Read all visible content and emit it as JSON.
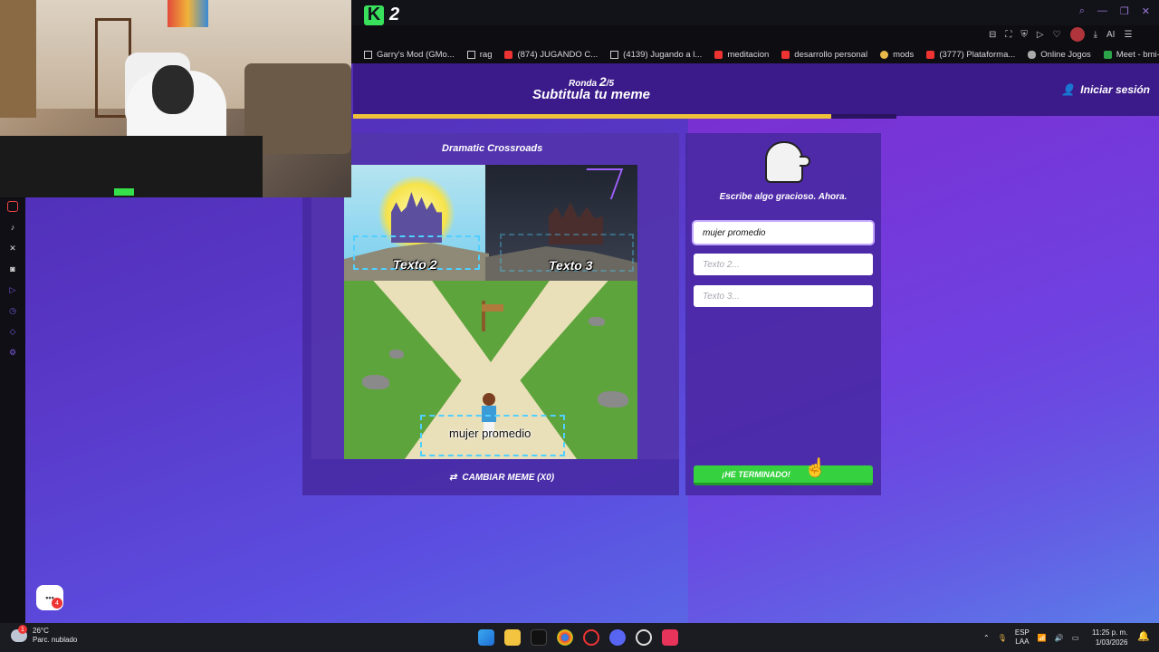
{
  "browser": {
    "app_logo": "K",
    "app_logo_suffix": "2",
    "bookmarks": [
      {
        "label": "Garry's Mod (GMo...",
        "icon": "doc-icon"
      },
      {
        "label": "rag",
        "icon": "doc-icon"
      },
      {
        "label": "(874) JUGANDO C...",
        "icon": "youtube-icon"
      },
      {
        "label": "(4139) Jugando a l...",
        "icon": "doc-icon"
      },
      {
        "label": "meditacion",
        "icon": "youtube-icon"
      },
      {
        "label": "desarrollo personal",
        "icon": "youtube-icon"
      },
      {
        "label": "mods",
        "icon": "star-icon"
      },
      {
        "label": "(3777) Plataforma...",
        "icon": "youtube-icon"
      },
      {
        "label": "Online Jogos",
        "icon": "cloud-icon"
      },
      {
        "label": "Meet - bmi-cosq-...",
        "icon": "meet-icon"
      }
    ],
    "top_icons": [
      "bookmark-icon",
      "screenshot-icon",
      "shield-icon",
      "play-icon",
      "heart-icon",
      "avatar",
      "download-icon",
      "ai-icon",
      "menu-icon"
    ],
    "ai_label": "AI"
  },
  "game": {
    "round_prefix": "Ronda",
    "round_current": "2",
    "round_total": "/5",
    "subtitle": "Subtitula tu meme",
    "login": "Iniciar sesión",
    "progress": 0.88,
    "meme_name": "Dramatic Crossroads",
    "captions": {
      "text2": "Texto 2",
      "text3": "Texto 3",
      "text1": "mujer promedio"
    },
    "change_meme": "CAMBIAR MEME (X0)",
    "prompt": "Escribe algo gracioso. Ahora.",
    "inputs": [
      {
        "value": "mujer promedio",
        "placeholder": ""
      },
      {
        "value": "",
        "placeholder": "Texto 2..."
      },
      {
        "value": "",
        "placeholder": "Texto 3..."
      }
    ],
    "done_button": "¡HE TERMINADO!",
    "chat_badge": "4",
    "chat_icon": "chat-icon"
  },
  "colors": {
    "accent_green": "#36d13f",
    "progress_yellow": "#f0c23a",
    "header_purple": "#3b1a8a"
  },
  "taskbar": {
    "temp": "26°C",
    "weather": "Parc. nublado",
    "weather_badge": "1",
    "lang1": "ESP",
    "lang2": "LAA",
    "time": "11:25 p. m.",
    "date": "1/03/2026"
  }
}
